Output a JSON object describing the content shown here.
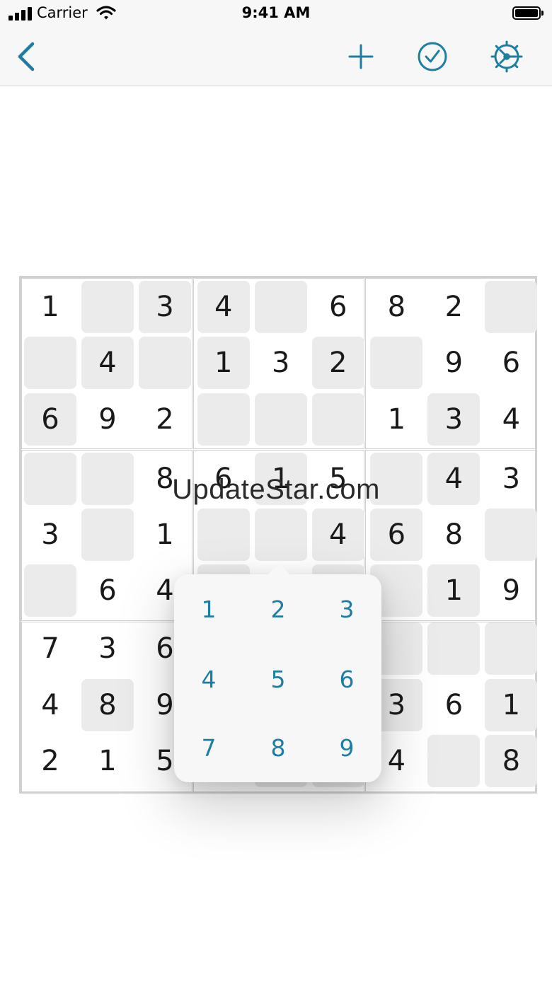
{
  "status_bar": {
    "carrier": "Carrier",
    "time": "9:41 AM"
  },
  "nav_bar": {
    "back_icon": "chevron-left-icon",
    "add_icon": "plus-icon",
    "check_icon": "check-circle-icon",
    "settings_icon": "gear-icon",
    "accent_color": "#1e7ea2"
  },
  "board": {
    "rows": [
      [
        "1",
        "",
        "3",
        "4",
        "",
        "6",
        "8",
        "2",
        ""
      ],
      [
        "",
        "4",
        "",
        "1",
        "3",
        "2",
        "",
        "9",
        "6"
      ],
      [
        "6",
        "9",
        "2",
        "",
        "",
        "",
        "1",
        "3",
        "4"
      ],
      [
        "",
        "",
        "8",
        "6",
        "1",
        "5",
        "",
        "4",
        "3"
      ],
      [
        "3",
        "",
        "1",
        "",
        "",
        "4",
        "6",
        "8",
        ""
      ],
      [
        "",
        "6",
        "4",
        "",
        "",
        "",
        "",
        "1",
        "9"
      ],
      [
        "7",
        "3",
        "6",
        "",
        "",
        "",
        "",
        "",
        ""
      ],
      [
        "4",
        "8",
        "9",
        "",
        "",
        "",
        "3",
        "6",
        "1"
      ],
      [
        "2",
        "1",
        "5",
        "",
        "",
        "",
        "4",
        "",
        "8"
      ]
    ],
    "shaded": [
      [
        false,
        true,
        true,
        true,
        true,
        false,
        false,
        false,
        true
      ],
      [
        true,
        true,
        true,
        true,
        false,
        true,
        true,
        false,
        false
      ],
      [
        true,
        false,
        false,
        true,
        true,
        true,
        false,
        true,
        false
      ],
      [
        true,
        true,
        false,
        false,
        true,
        false,
        true,
        true,
        false
      ],
      [
        false,
        true,
        false,
        true,
        true,
        true,
        true,
        false,
        true
      ],
      [
        true,
        false,
        false,
        true,
        false,
        true,
        true,
        true,
        false
      ],
      [
        false,
        false,
        false,
        false,
        true,
        false,
        true,
        true,
        true
      ],
      [
        false,
        true,
        false,
        false,
        false,
        false,
        true,
        false,
        true
      ],
      [
        false,
        false,
        false,
        false,
        true,
        true,
        false,
        true,
        true
      ]
    ],
    "empty_color": "#ebebeb"
  },
  "number_picker": {
    "keys": [
      "1",
      "2",
      "3",
      "4",
      "5",
      "6",
      "7",
      "8",
      "9"
    ],
    "text_color": "#1e7ea2"
  },
  "watermark": "UpdateStar.com"
}
